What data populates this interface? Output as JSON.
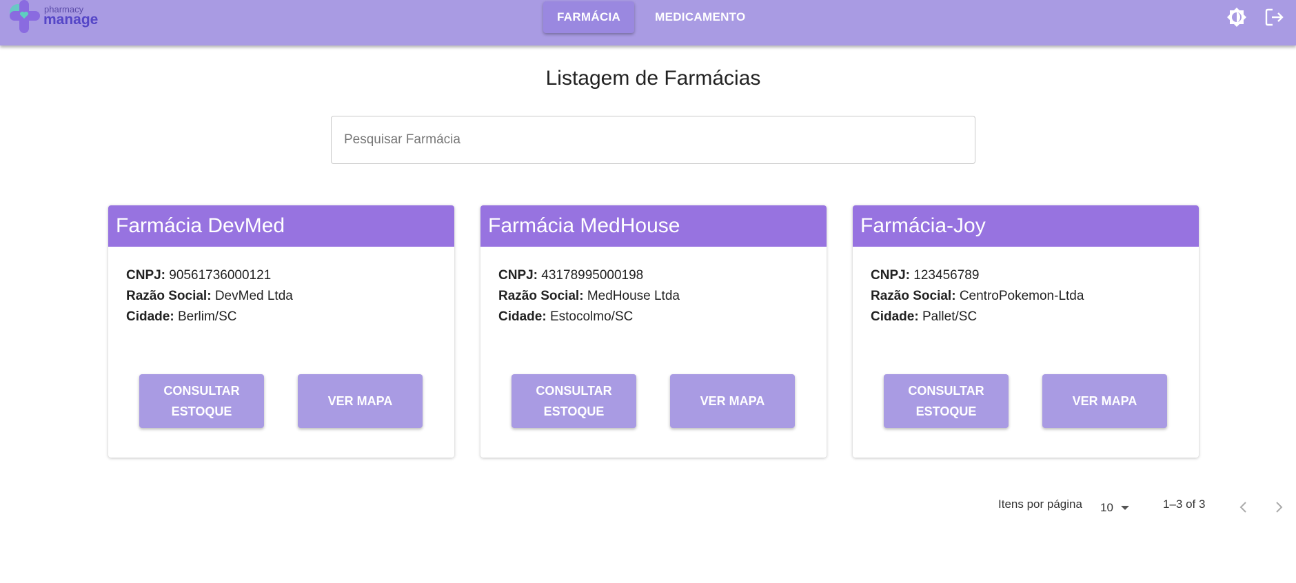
{
  "app": {
    "logo_small": "pharmacy",
    "logo_big": "manage"
  },
  "nav": {
    "items": [
      {
        "label": "FARMÁCIA",
        "active": true
      },
      {
        "label": "MEDICAMENTO",
        "active": false
      }
    ]
  },
  "toolbar_icons": [
    "brightness-icon",
    "logout-icon"
  ],
  "page": {
    "title": "Listagem de Farmácias"
  },
  "search": {
    "placeholder": "Pesquisar Farmácia",
    "value": ""
  },
  "labels": {
    "cnpj": "CNPJ:",
    "razao": "Razão Social:",
    "cidade": "Cidade:"
  },
  "cards": [
    {
      "name": "Farmácia DevMed",
      "cnpj": "90561736000121",
      "razao_social": "DevMed Ltda",
      "cidade": "Berlim/SC",
      "btn_estoque": "CONSULTAR ESTOQUE",
      "btn_mapa": "VER MAPA"
    },
    {
      "name": "Farmácia MedHouse",
      "cnpj": "43178995000198",
      "razao_social": "MedHouse Ltda",
      "cidade": "Estocolmo/SC",
      "btn_estoque": "CONSULTAR ESTOQUE",
      "btn_mapa": "VER MAPA"
    },
    {
      "name": "Farmácia-Joy",
      "cnpj": "123456789",
      "razao_social": "CentroPokemon-Ltda",
      "cidade": "Pallet/SC",
      "btn_estoque": "CONSULTAR ESTOQUE",
      "btn_mapa": "VER MAPA"
    }
  ],
  "pagination": {
    "items_per_page_label": "Itens por página",
    "items_per_page": "10",
    "range": "1–3 of 3"
  },
  "colors": {
    "topbar": "#a99be3",
    "card_header": "#9773e0",
    "button": "#a99be3"
  }
}
